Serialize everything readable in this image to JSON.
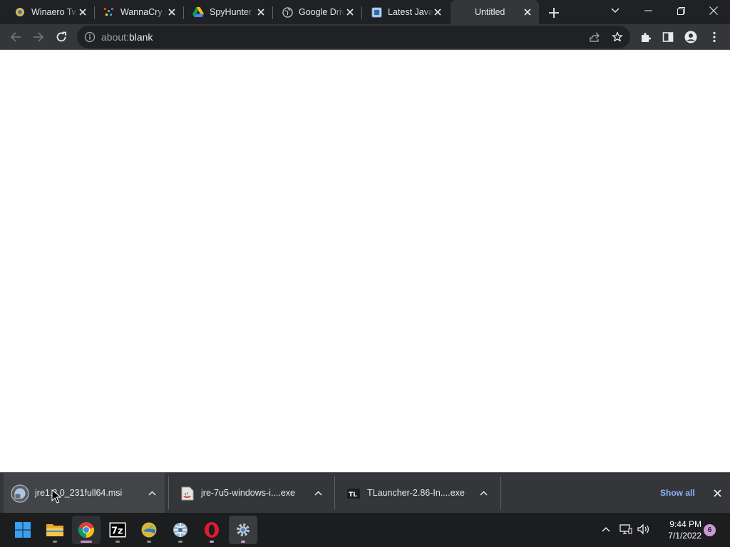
{
  "browser": {
    "tabs": [
      {
        "title": "Winaero Tweaker",
        "icon": "winaero-icon"
      },
      {
        "title": "WannaCry ransomware",
        "icon": "wannacry-icon"
      },
      {
        "title": "SpyHunter",
        "icon": "google-drive-icon"
      },
      {
        "title": "Google Drive",
        "icon": "globe-icon"
      },
      {
        "title": "Latest Java",
        "icon": "java-doc-icon"
      },
      {
        "title": "Untitled",
        "icon": "none",
        "active": true
      }
    ],
    "address": {
      "scheme": "about:",
      "path": "blank"
    }
  },
  "downloads": {
    "items": [
      {
        "name": "jre1.8.0_231full64.msi",
        "icon": "msi-installer-icon"
      },
      {
        "name": "jre-7u5-windows-i....exe",
        "icon": "java-installer-icon"
      },
      {
        "name": "TLauncher-2.86-In....exe",
        "icon": "tlauncher-icon"
      }
    ],
    "show_all": "Show all"
  },
  "taskbar": {
    "apps": [
      "start-icon",
      "file-explorer-icon",
      "chrome-icon",
      "7zip-icon",
      "winaero-icon",
      "network-app-icon",
      "opera-icon",
      "settings-icon"
    ],
    "time": "9:44 PM",
    "date": "7/1/2022",
    "notifications": "6"
  },
  "colors": {
    "titlebar": "#202124",
    "toolbar": "#35363a",
    "accent_link": "#8ab4f8",
    "taskbar": "#1c1d1f"
  }
}
